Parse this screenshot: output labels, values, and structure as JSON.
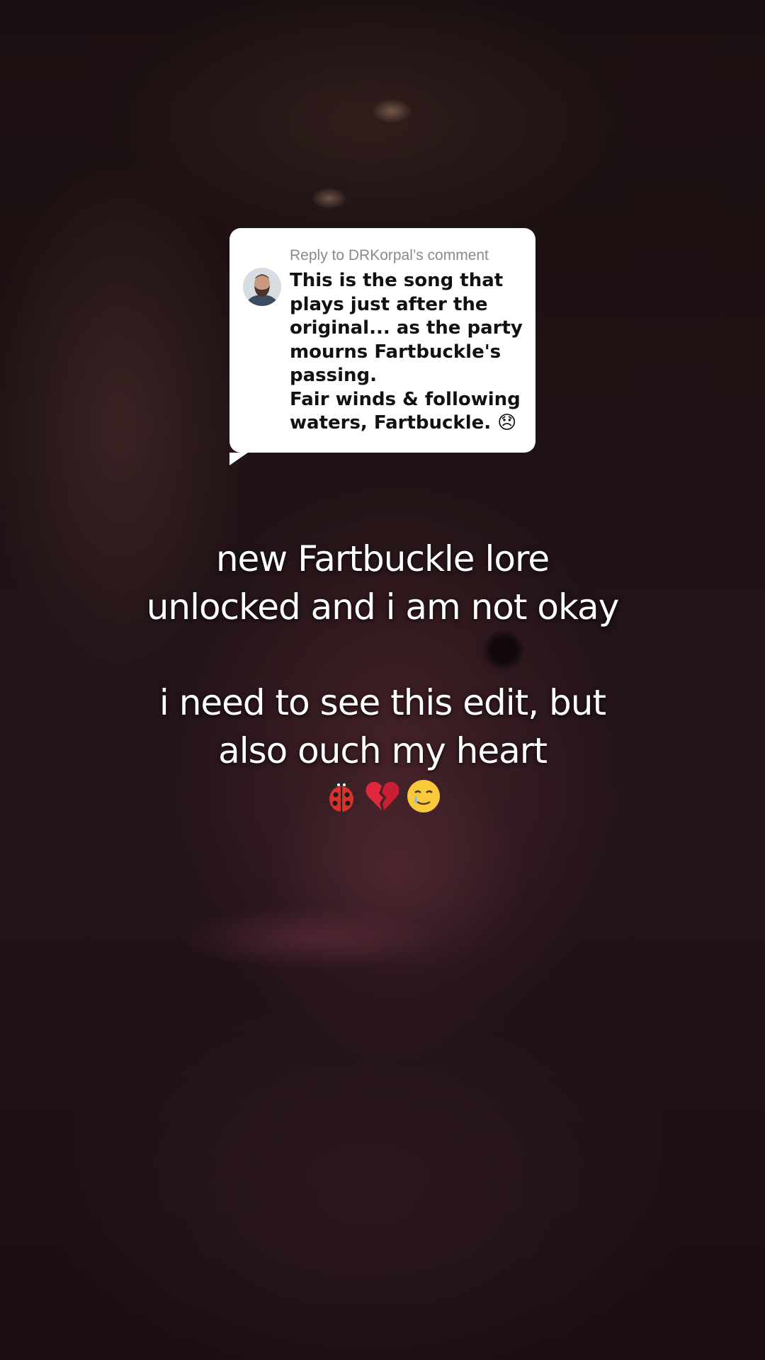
{
  "reply_card": {
    "header": "Reply to DRKorpal’s comment",
    "lines": [
      "This is the song that",
      "plays just after the",
      "original... as the party",
      "mourns Fartbuckle's",
      "passing.",
      "Fair winds & following",
      "waters, Fartbuckle. 😞"
    ]
  },
  "caption": {
    "lines_top": [
      "new Fartbuckle lore",
      "unlocked and i am not okay"
    ],
    "lines_bottom": [
      "i need to see this edit, but",
      "also ouch my heart"
    ],
    "emojis": [
      "🐞",
      "💔",
      "🥲"
    ]
  },
  "icons": {
    "ladybug": "ladybug-emoji",
    "broken_heart": "broken-heart-emoji",
    "tear_smile": "smiling-face-with-tear-emoji",
    "sad_face": "disappointed-face-emoji"
  },
  "colors": {
    "card_background": "#ffffff",
    "card_text": "#111111",
    "card_header": "#8a8a8a",
    "caption_text": "#ffffff"
  }
}
